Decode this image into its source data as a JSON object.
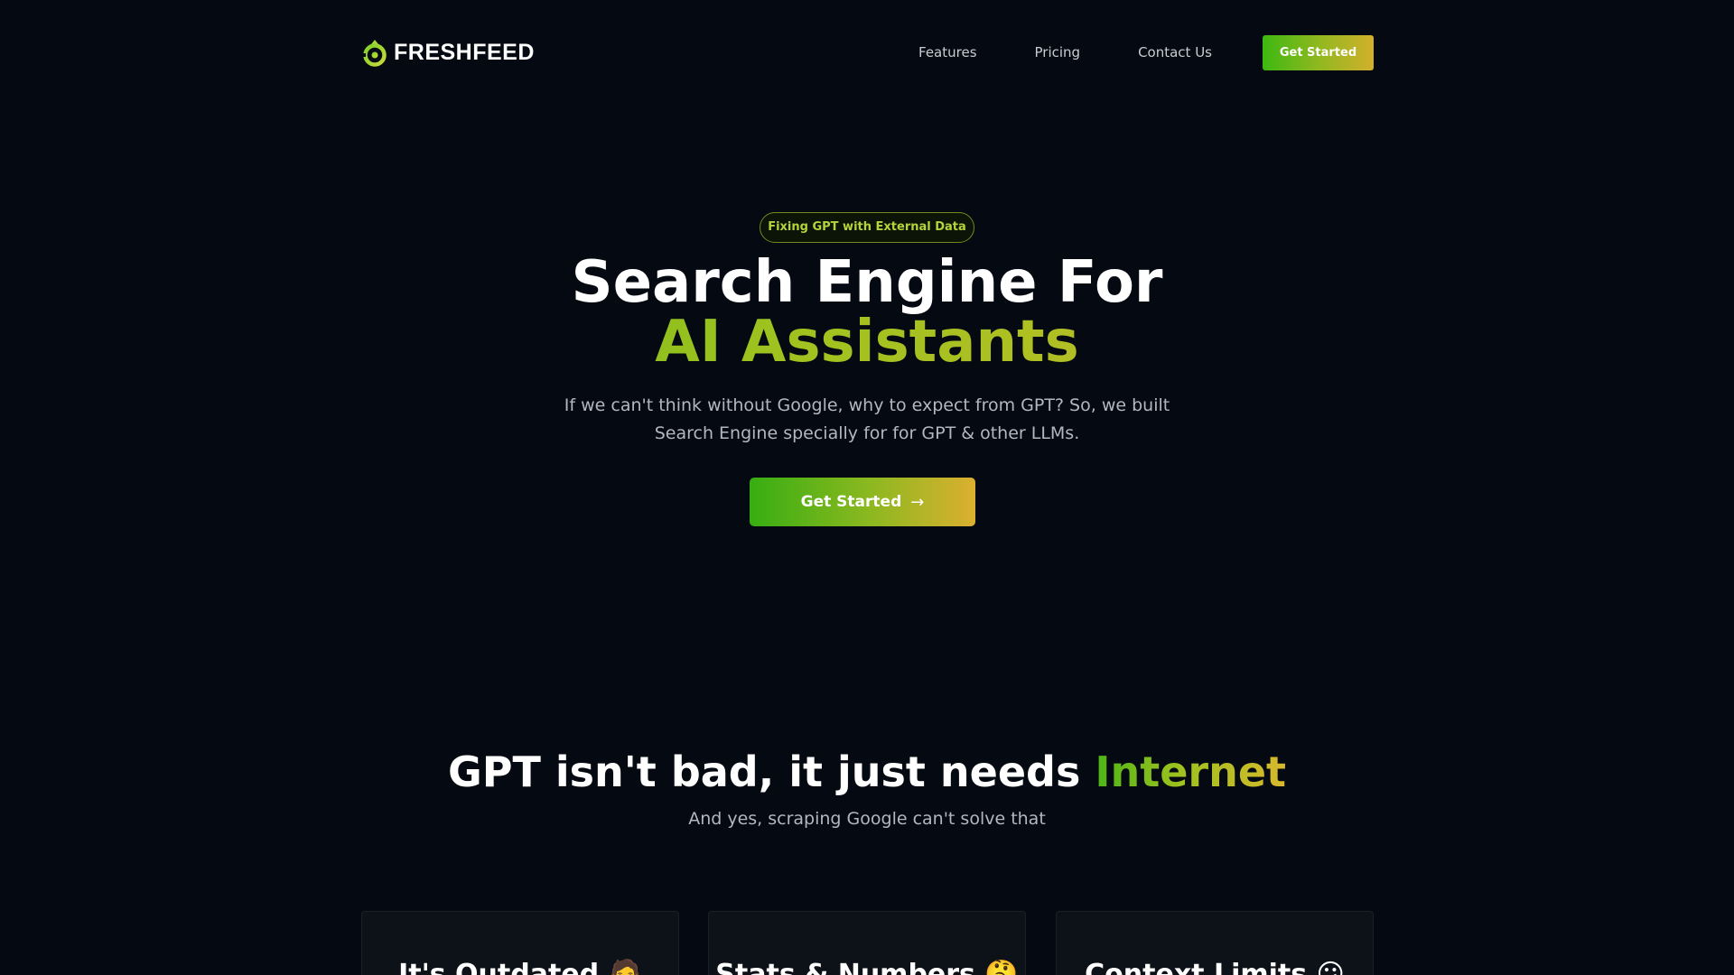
{
  "header": {
    "logo_text": "FRESHFEED",
    "nav": [
      {
        "label": "Features"
      },
      {
        "label": "Pricing"
      },
      {
        "label": "Contact Us"
      }
    ],
    "cta_label": "Get Started"
  },
  "hero": {
    "badge": "Fixing GPT with External Data",
    "title_line1": "Search Engine For",
    "title_line2": "AI Assistants",
    "subtitle": "If we can't think without Google, why to expect from GPT? So, we built Search Engine specially for for GPT & other LLMs.",
    "cta_label": "Get Started",
    "cta_icon": "arrow-right-icon"
  },
  "section": {
    "title_prefix": "GPT isn't bad, it just needs ",
    "title_highlight": "Internet",
    "subtitle": "And yes, scraping Google can't solve that"
  },
  "cards": [
    {
      "title": "It's Outdated 🧔"
    },
    {
      "title": "Stats & Numbers 🤔"
    },
    {
      "title": "Context Limits 😕"
    }
  ],
  "colors": {
    "background": "#050911",
    "accent_green": "#3db812",
    "accent_gold": "#d3b02c",
    "badge_text": "#b6d33a",
    "muted_text": "#b3b7c0"
  }
}
